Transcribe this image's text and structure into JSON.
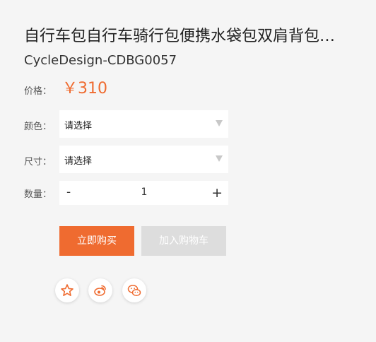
{
  "product": {
    "title": "自行车包自行车骑行包便携水袋包双肩背包…",
    "sku": "CycleDesign-CDBG0057"
  },
  "price": {
    "label": "价格：",
    "value": "￥310"
  },
  "color": {
    "label": "颜色：",
    "selected": "请选择"
  },
  "size": {
    "label": "尺寸：",
    "selected": "请选择"
  },
  "quantity": {
    "label": "数量：",
    "minus": "-",
    "value": "1",
    "plus": "+"
  },
  "actions": {
    "buy_now": "立即购买",
    "add_to_cart": "加入购物车"
  },
  "share": {
    "icons": [
      "star-icon",
      "weibo-icon",
      "wechat-icon"
    ]
  },
  "colors": {
    "accent": "#ef6b30",
    "disabled": "#dddddd",
    "background": "#f5f5f5"
  }
}
